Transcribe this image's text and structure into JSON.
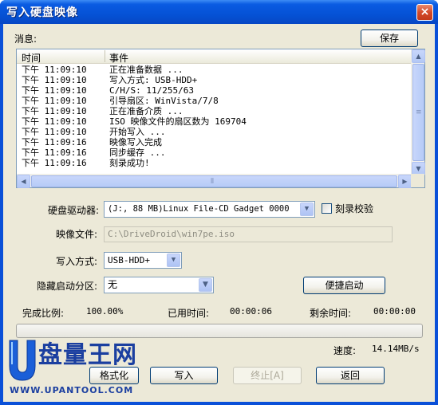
{
  "window": {
    "title": "写入硬盘映像",
    "close_glyph": "×"
  },
  "messages": {
    "label": "消息:",
    "save_button": "保存",
    "columns": {
      "time": "时间",
      "event": "事件"
    },
    "rows": [
      {
        "time": "下午 11:09:10",
        "event": "正在准备数据 ..."
      },
      {
        "time": "下午 11:09:10",
        "event": "写入方式: USB-HDD+"
      },
      {
        "time": "下午 11:09:10",
        "event": "C/H/S: 11/255/63"
      },
      {
        "time": "下午 11:09:10",
        "event": "引导扇区: WinVista/7/8"
      },
      {
        "time": "下午 11:09:10",
        "event": "正在准备介质 ..."
      },
      {
        "time": "下午 11:09:10",
        "event": "ISO 映像文件的扇区数为 169704"
      },
      {
        "time": "下午 11:09:10",
        "event": "开始写入 ..."
      },
      {
        "time": "下午 11:09:16",
        "event": "映像写入完成"
      },
      {
        "time": "下午 11:09:16",
        "event": "同步缓存 ..."
      },
      {
        "time": "下午 11:09:16",
        "event": "刻录成功!"
      }
    ]
  },
  "form": {
    "drive_label": "硬盘驱动器:",
    "drive_value": "(J:, 88 MB)Linux   File-CD Gadget  0000",
    "verify_label": "刻录校验",
    "verify_checked": false,
    "image_label": "映像文件:",
    "image_value": "C:\\DriveDroid\\win7pe.iso",
    "method_label": "写入方式:",
    "method_value": "USB-HDD+",
    "hidden_label": "隐藏启动分区:",
    "hidden_value": "无",
    "quick_boot_button": "便捷启动"
  },
  "status": {
    "complete_label": "完成比例:",
    "complete_value": "100.00%",
    "elapsed_label": "已用时间:",
    "elapsed_value": "00:00:06",
    "remaining_label": "剩余时间:",
    "remaining_value": "00:00:00",
    "progress_fraction": 1.0,
    "speed_label": "速度:",
    "speed_value": "14.14MB/s"
  },
  "actions": {
    "format_button": "格式化",
    "write_button": "写入",
    "abort_button": "终止[A]",
    "return_button": "返回"
  },
  "watermark": {
    "brand": "盘量王网",
    "url": "WWW.UPANTOOL.COM"
  }
}
